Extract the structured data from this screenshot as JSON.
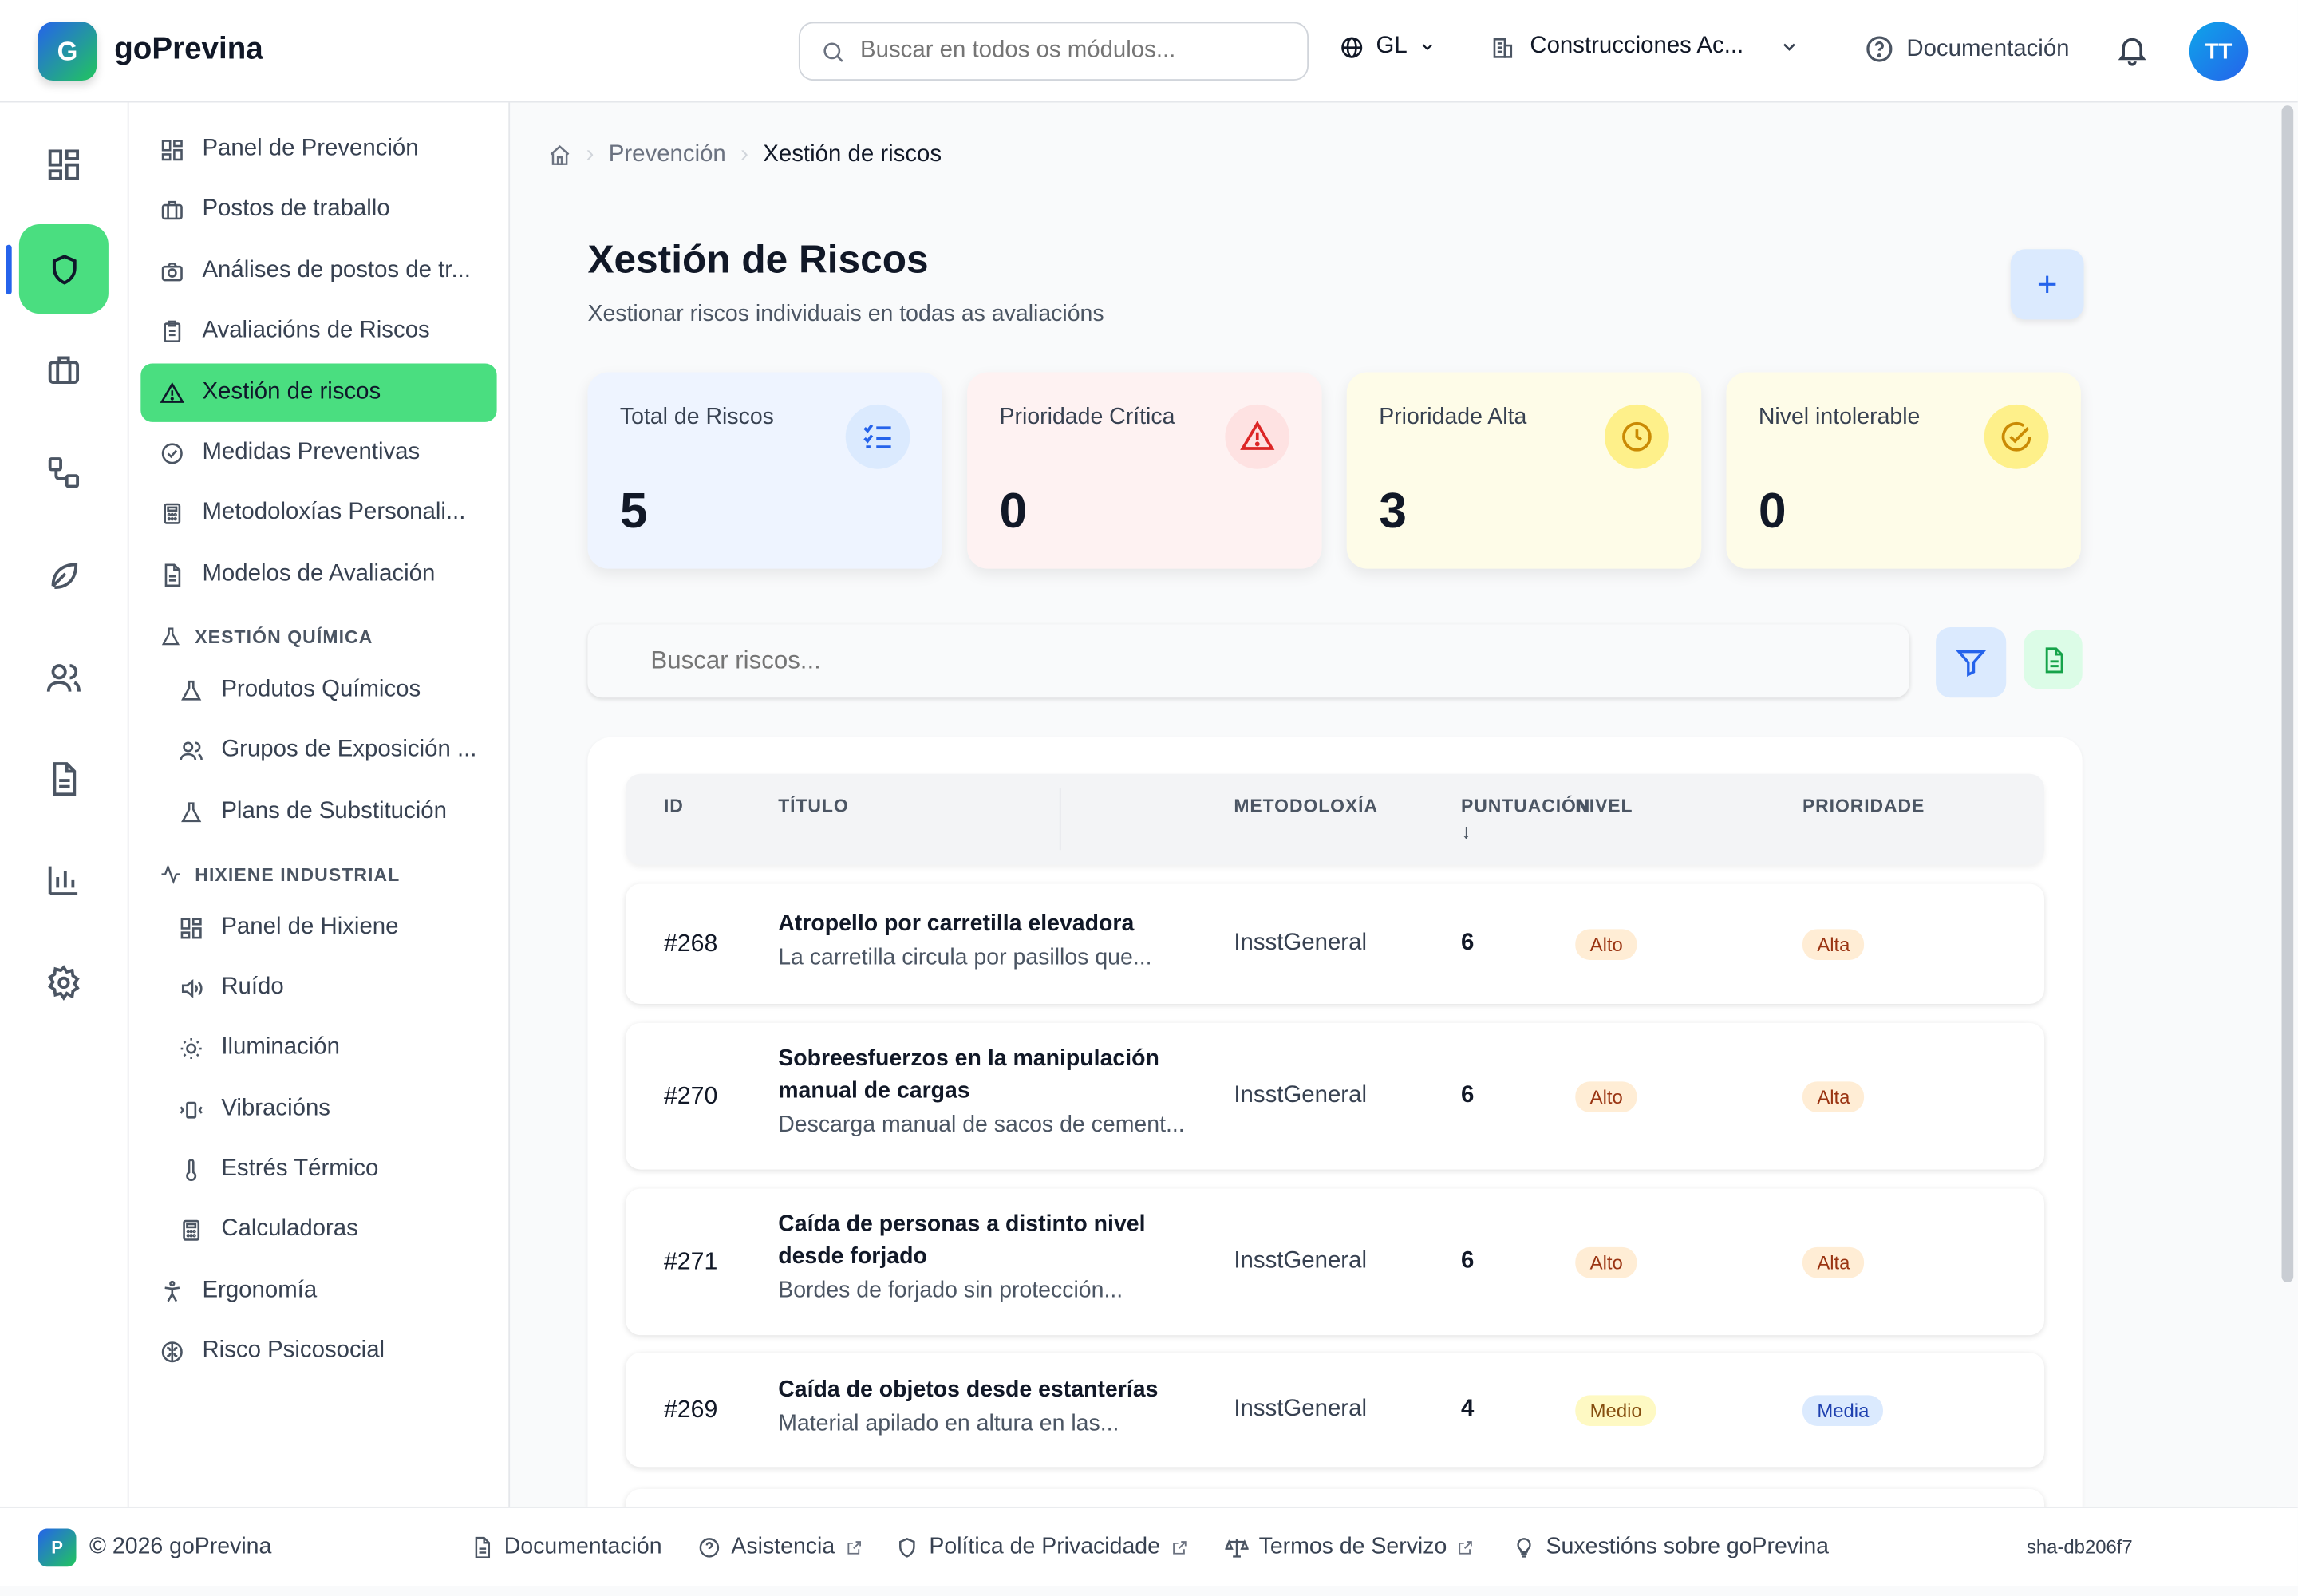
{
  "app": {
    "logo_letter": "G",
    "brand": "goPrevina",
    "search_placeholder": "Buscar en todos os módulos...",
    "language": "GL",
    "company": "Construcciones Ac...",
    "docs_label": "Documentación",
    "user_initials": "TT"
  },
  "rail": {
    "items": [
      "dashboard-icon",
      "shield-icon",
      "briefcase-icon",
      "workflow-icon",
      "leaf-icon",
      "users-icon",
      "document-icon",
      "bar-chart-icon",
      "settings-icon"
    ],
    "active": "shield-icon"
  },
  "nav": {
    "items": [
      {
        "label": "Panel de Prevención",
        "icon": "dashboard-icon"
      },
      {
        "label": "Postos de traballo",
        "icon": "briefcase-icon"
      },
      {
        "label": "Análises de postos de tr...",
        "icon": "camera-icon"
      },
      {
        "label": "Avaliacións de Riscos",
        "icon": "clipboard-icon"
      },
      {
        "label": "Xestión de riscos",
        "icon": "warning-icon",
        "active": true
      },
      {
        "label": "Medidas Preventivas",
        "icon": "check-circle-icon"
      },
      {
        "label": "Metodoloxías Personali...",
        "icon": "calculator-icon"
      },
      {
        "label": "Modelos de Avaliación",
        "icon": "file-icon"
      }
    ],
    "section_chemical": "XESTIÓN QUÍMICA",
    "chemical_items": [
      {
        "label": "Produtos Químicos",
        "icon": "flask-icon"
      },
      {
        "label": "Grupos de Exposición ...",
        "icon": "users-icon"
      },
      {
        "label": "Plans de Substitución",
        "icon": "flask-icon"
      }
    ],
    "section_hygiene": "HIXIENE INDUSTRIAL",
    "hygiene_items": [
      {
        "label": "Panel de Hixiene",
        "icon": "dashboard-icon"
      },
      {
        "label": "Ruído",
        "icon": "speaker-icon"
      },
      {
        "label": "Iluminación",
        "icon": "sun-icon"
      },
      {
        "label": "Vibracións",
        "icon": "vibration-icon"
      },
      {
        "label": "Estrés Térmico",
        "icon": "thermometer-icon"
      },
      {
        "label": "Calculadoras",
        "icon": "calculator-icon"
      }
    ],
    "bottom_items": [
      {
        "label": "Ergonomía",
        "icon": "accessibility-icon"
      },
      {
        "label": "Risco Psicosocial",
        "icon": "brain-icon"
      }
    ]
  },
  "breadcrumb": {
    "parent": "Prevención",
    "current": "Xestión de riscos"
  },
  "page": {
    "title": "Xestión de Riscos",
    "subtitle": "Xestionar riscos individuais en todas as avaliacións"
  },
  "stats": [
    {
      "label": "Total de Riscos",
      "value": "5",
      "bg": "#eef4ff",
      "icon": "list-check-icon",
      "accent": "#2563eb",
      "badge_bg": "#dbeafe"
    },
    {
      "label": "Prioridade Crítica",
      "value": "0",
      "bg": "#fef2f2",
      "icon": "alert-triangle-icon",
      "accent": "#dc2626",
      "badge_bg": "#fee2e2"
    },
    {
      "label": "Prioridade Alta",
      "value": "3",
      "bg": "#fefce8",
      "icon": "clock-icon",
      "accent": "#ca8a04",
      "badge_bg": "#fef08a"
    },
    {
      "label": "Nivel intolerable",
      "value": "0",
      "bg": "#fefce8",
      "icon": "check-badge-icon",
      "accent": "#ca8a04",
      "badge_bg": "#fef08a"
    }
  ],
  "risk_search_placeholder": "Buscar riscos...",
  "table": {
    "headers": {
      "id": "ID",
      "title": "TÍTULO",
      "methodology": "METODOLOXÍA",
      "score": "PUNTUACIÓN",
      "level": "NIVEL",
      "priority": "PRIORIDADE"
    },
    "rows": [
      {
        "id": "#268",
        "title": "Atropello por carretilla elevadora",
        "desc": "La carretilla circula por pasillos que...",
        "methodology": "InsstGeneral",
        "score": "6",
        "level": "Alto",
        "priority": "Alta"
      },
      {
        "id": "#270",
        "title": "Sobreesfuerzos en la manipulación manual de cargas",
        "desc": "Descarga manual de sacos de cement...",
        "methodology": "InsstGeneral",
        "score": "6",
        "level": "Alto",
        "priority": "Alta"
      },
      {
        "id": "#271",
        "title": "Caída de personas a distinto nivel desde forjado",
        "desc": "Bordes de forjado sin protección...",
        "methodology": "InsstGeneral",
        "score": "6",
        "level": "Alto",
        "priority": "Alta"
      },
      {
        "id": "#269",
        "title": "Caída de objetos desde estanterías",
        "desc": "Material apilado en altura en las...",
        "methodology": "InsstGeneral",
        "score": "4",
        "level": "Medio",
        "priority": "Media"
      }
    ]
  },
  "footer": {
    "logo_letter": "P",
    "copyright": "© 2026 goPrevina",
    "links": [
      "Documentación",
      "Asistencia",
      "Política de Privacidade",
      "Termos de Servizo",
      "Suxestións sobre goPrevina"
    ],
    "sha": "sha-db206f7"
  }
}
